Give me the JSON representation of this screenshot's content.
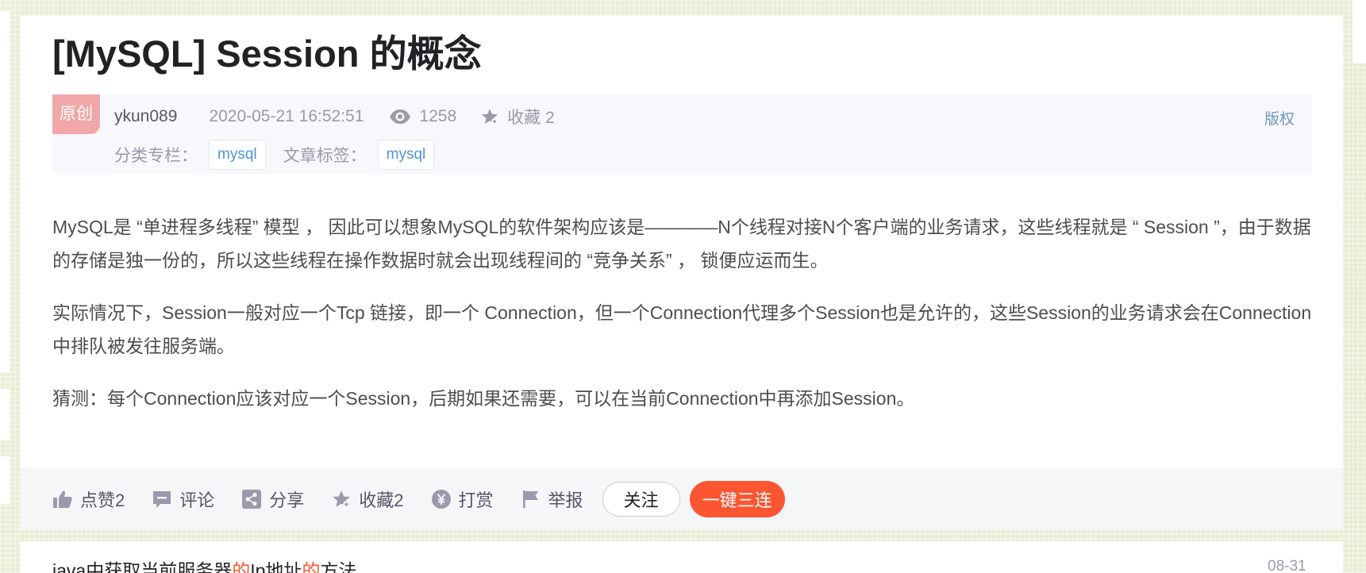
{
  "article": {
    "title": "[MySQL] Session 的概念",
    "badge": "原创",
    "author": "ykun089",
    "date": "2020-05-21 16:52:51",
    "views": "1258",
    "collect_label": "收藏 2",
    "copyright": "版权",
    "category_label": "分类专栏：",
    "category_tag": "mysql",
    "tags_label": "文章标签：",
    "tag": "mysql",
    "paragraphs": [
      "MySQL是 “单进程多线程” 模型 ， 因此可以想象MySQL的软件架构应该是————N个线程对接N个客户端的业务请求，这些线程就是 “ Session ”，由于数据的存储是独一份的，所以这些线程在操作数据时就会出现线程间的 “竞争关系” ， 锁便应运而生。",
      "实际情况下，Session一般对应一个Tcp 链接，即一个 Connection，但一个Connection代理多个Session也是允许的，这些Session的业务请求会在Connection中排队被发往服务端。",
      "猜测：每个Connection应该对应一个Session，后期如果还需要，可以在当前Connection中再添加Session。"
    ]
  },
  "toolbar": {
    "like": "点赞2",
    "comment": "评论",
    "share": "分享",
    "collect": "收藏2",
    "reward": "打赏",
    "report": "举报",
    "follow": "关注",
    "triple": "一键三连"
  },
  "next": {
    "title_parts": [
      "java中获取当前服务器",
      "的",
      "Ip地址",
      "的",
      "方法"
    ],
    "date": "08-31"
  },
  "colors": {
    "accent": "#fc5531",
    "badge": "#f1a7a7",
    "link": "#5094d5"
  }
}
